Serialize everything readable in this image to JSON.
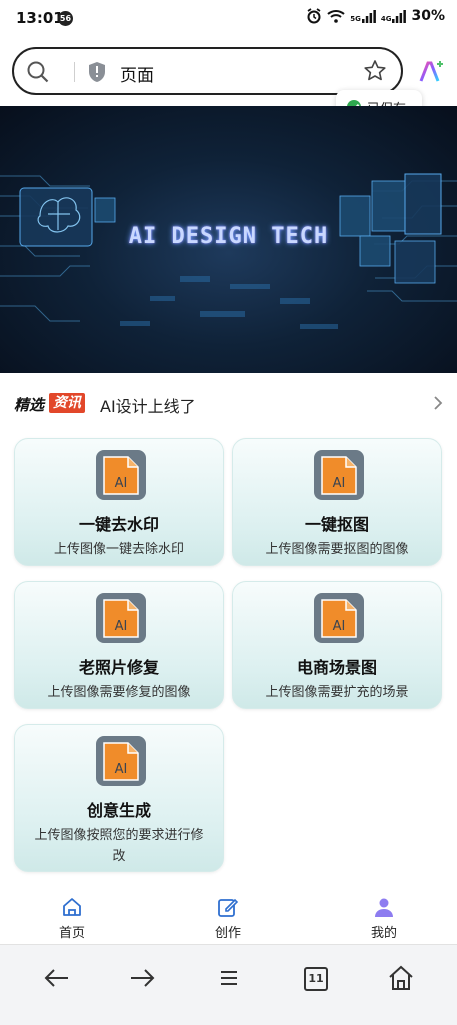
{
  "status_bar": {
    "time": "13:01",
    "badge": "56",
    "battery": "30%",
    "network_a": "5G",
    "network_b": "4G"
  },
  "address_bar": {
    "text": "页面"
  },
  "toast": {
    "text": "已保存"
  },
  "banner": {
    "title": "AI DESIGN TECH"
  },
  "news": {
    "logo_a": "精选",
    "logo_b": "资讯",
    "text": "AI设计上线了"
  },
  "cards": [
    {
      "title": "一键去水印",
      "subtitle": "上传图像一键去除水印",
      "icon_label": "AI"
    },
    {
      "title": "一键抠图",
      "subtitle": "上传图像需要抠图的图像",
      "icon_label": "AI"
    },
    {
      "title": "老照片修复",
      "subtitle": "上传图像需要修复的图像",
      "icon_label": "AI"
    },
    {
      "title": "电商场景图",
      "subtitle": "上传图像需要扩充的场景",
      "icon_label": "AI"
    },
    {
      "title": "创意生成",
      "subtitle": "上传图像按照您的要求进行修改",
      "icon_label": "AI"
    }
  ],
  "bottom_nav": [
    {
      "label": "首页",
      "icon": "home-icon"
    },
    {
      "label": "创作",
      "icon": "edit-icon"
    },
    {
      "label": "我的",
      "icon": "user-icon"
    }
  ],
  "toolbar": {
    "tab_count": "11"
  },
  "colors": {
    "accent_blue": "#2f6fcf",
    "card_bg": "#dcf0f0",
    "ai_icon_orange": "#f08c2a",
    "news_red": "#e2472a"
  }
}
